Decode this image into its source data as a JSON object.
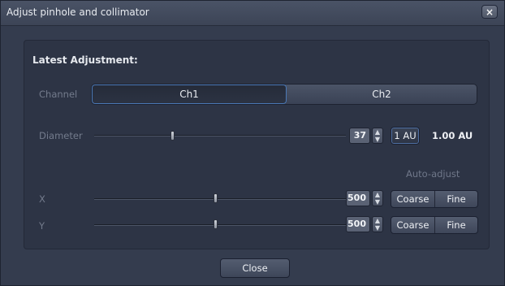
{
  "dialog": {
    "title": "Adjust pinhole and collimator",
    "close_icon": "close-icon"
  },
  "panel": {
    "section_title": "Latest Adjustment:",
    "channel": {
      "label": "Channel",
      "options": [
        "Ch1",
        "Ch2"
      ],
      "selected": "Ch1"
    },
    "diameter": {
      "label": "Diameter",
      "value": "37",
      "slider_fraction": 0.31,
      "au_button": "1 AU",
      "au_readout": "1.00 AU"
    },
    "auto_adjust_label": "Auto-adjust",
    "x": {
      "label": "X",
      "value": "500",
      "slider_fraction": 0.48,
      "coarse": "Coarse",
      "fine": "Fine"
    },
    "y": {
      "label": "Y",
      "value": "500",
      "slider_fraction": 0.48,
      "coarse": "Coarse",
      "fine": "Fine"
    }
  },
  "footer": {
    "close_label": "Close"
  },
  "colors": {
    "background": "#343c4e",
    "panel": "#2d3445",
    "accent_border": "#4a78b5"
  }
}
